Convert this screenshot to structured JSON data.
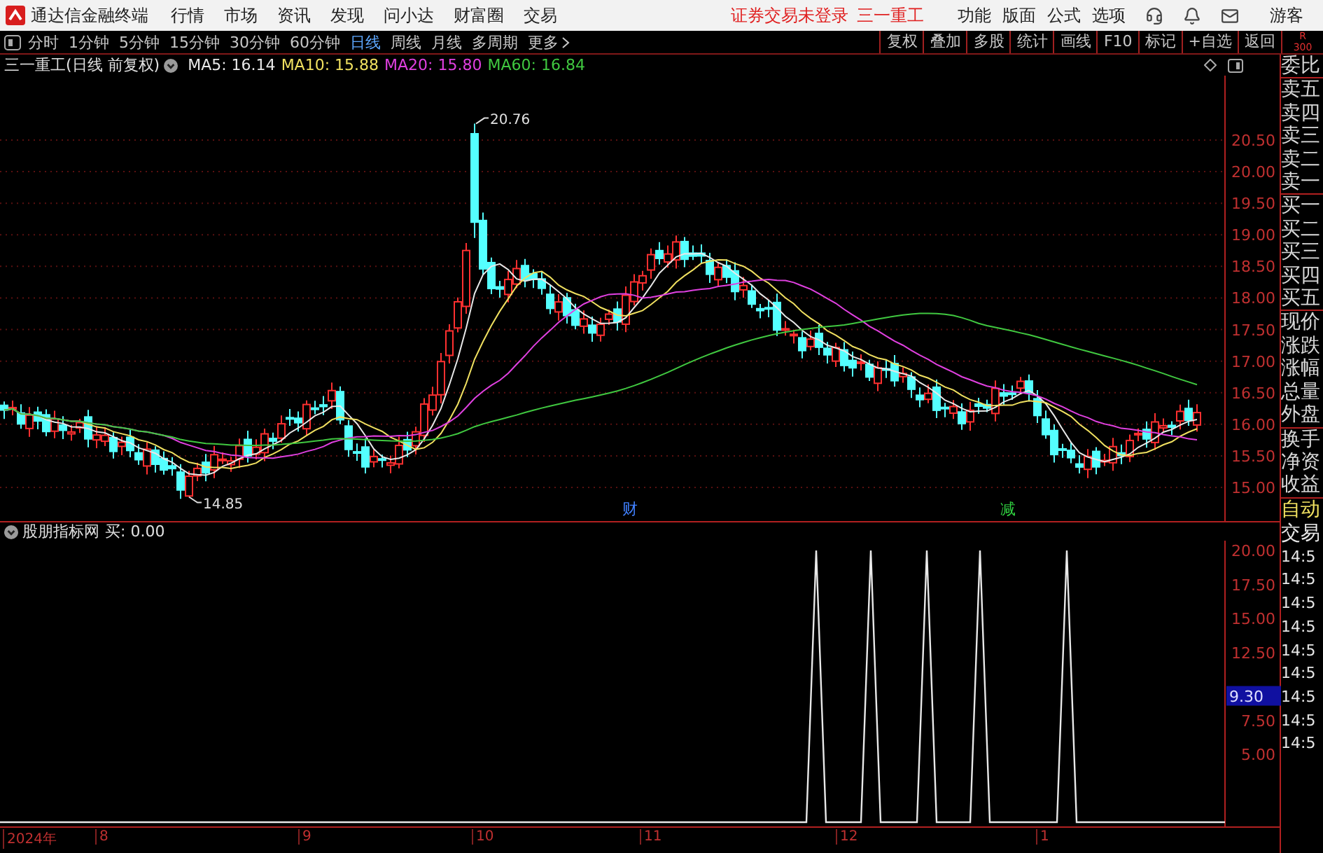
{
  "title_bar": {
    "app_name": "通达信金融终端",
    "menu": [
      "行情",
      "市场",
      "资讯",
      "发现",
      "问小达",
      "财富圈",
      "交易"
    ],
    "notices": [
      "证券交易未登录",
      "三一重工"
    ],
    "functions": [
      "功能",
      "版面",
      "公式",
      "选项"
    ],
    "user": "游客"
  },
  "toolbar": {
    "periods": [
      {
        "label": "分时",
        "selected": false
      },
      {
        "label": "1分钟",
        "selected": false
      },
      {
        "label": "5分钟",
        "selected": false
      },
      {
        "label": "15分钟",
        "selected": false
      },
      {
        "label": "30分钟",
        "selected": false
      },
      {
        "label": "60分钟",
        "selected": false
      },
      {
        "label": "日线",
        "selected": true
      },
      {
        "label": "周线",
        "selected": false
      },
      {
        "label": "月线",
        "selected": false
      },
      {
        "label": "多周期",
        "selected": false
      }
    ],
    "more": "更多",
    "buttons": [
      "复权",
      "叠加",
      "多股",
      "统计",
      "画线",
      "F10",
      "标记",
      "+自选",
      "返回"
    ]
  },
  "corner": {
    "label": "R",
    "value": "300"
  },
  "legend": {
    "title": "三一重工(日线 前复权)",
    "averages": [
      {
        "label": "MA5: 16.14",
        "color": "#e8e8e8"
      },
      {
        "label": "MA10: 15.88",
        "color": "#f0e060"
      },
      {
        "label": "MA20: 15.80",
        "color": "#e040e0"
      },
      {
        "label": "MA60: 16.84",
        "color": "#40c840"
      }
    ]
  },
  "price_chart": {
    "y_labels": [
      "20.50",
      "20.00",
      "19.50",
      "19.00",
      "18.50",
      "18.00",
      "17.50",
      "17.00",
      "16.50",
      "16.00",
      "15.50",
      "15.00"
    ],
    "high_label": "20.76",
    "low_label": "14.85",
    "events": [
      {
        "label": "财",
        "color": "#4080ff"
      },
      {
        "label": "减",
        "color": "#30d040"
      }
    ]
  },
  "indicator": {
    "name": "股朋指标网",
    "reading": "买: 0.00",
    "y_labels": [
      "20.00",
      "17.50",
      "15.00",
      "12.50",
      "7.50",
      "5.00"
    ],
    "current": "9.30"
  },
  "date_axis": [
    "2024年",
    "8",
    "9",
    "10",
    "11",
    "12",
    "1"
  ],
  "side_panel": {
    "quote_groups": [
      [
        "委比"
      ],
      [
        "卖五",
        "卖四",
        "卖三",
        "卖二",
        "卖一"
      ],
      [
        "买一",
        "买二",
        "买三",
        "买四",
        "买五"
      ],
      [
        "现价",
        "涨跌",
        "涨幅",
        "总量",
        "外盘"
      ],
      [
        "换手",
        "净资",
        "收益"
      ]
    ],
    "trade_rows": [
      {
        "kind": "mode",
        "label": "自动"
      },
      {
        "kind": "heading",
        "label": "交易"
      },
      {
        "kind": "time",
        "label": "14:5"
      },
      {
        "kind": "time",
        "label": "14:5"
      },
      {
        "kind": "time",
        "label": "14:5"
      },
      {
        "kind": "time",
        "label": "14:5"
      },
      {
        "kind": "time",
        "label": "14:5"
      },
      {
        "kind": "time",
        "label": "14:5"
      },
      {
        "kind": "time",
        "label": "14:5"
      },
      {
        "kind": "time",
        "label": "14:5"
      },
      {
        "kind": "time",
        "label": "14:5"
      }
    ]
  }
}
